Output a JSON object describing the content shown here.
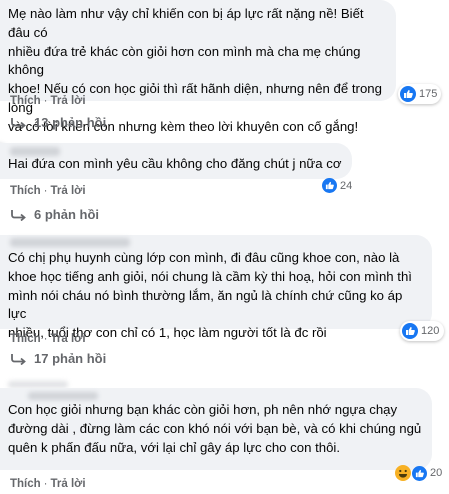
{
  "comments": [
    {
      "text": "Mẹ nào làm như vậy chỉ khiến con bị áp lực rất nặng nề! Biết đâu có\nnhiều đứa trẻ khác còn giỏi hơn con mình mà cha mẹ chúng không\nkhoe! Nếu có con học giỏi thì rất hãnh diện, nhưng nên để trong lòng\nvà có lời khen con nhưng kèm theo lời khuyên con cố gắng!",
      "like_label": "Thích",
      "reply_label": "Trả lời",
      "reaction_count": "175",
      "replies_label": "13 phản hồi"
    },
    {
      "text": "Hai đứa con mình yêu cầu không cho đăng chút j nữa cơ",
      "like_label": "Thích",
      "reply_label": "Trả lời",
      "reaction_count": "24",
      "replies_label": "6 phản hồi"
    },
    {
      "text": "Có chị phụ huynh cùng lớp con mình, đi đâu cũng khoe con, nào là\nkhoe học tiếng anh giỏi, nói chung là cầm kỳ thi hoạ, hỏi con mình thì\nmình nói cháu nó bình thường lắm, ăn ngủ là chính chứ cũng ko áp lực\nnhiều, tuổi thơ con chỉ có 1, học làm người tốt là đc rồi",
      "like_label": "Thích",
      "reply_label": "Trả lời",
      "reaction_count": "120",
      "replies_label": "17 phản hồi"
    },
    {
      "text": "Con học giỏi nhưng bạn khác còn giỏi hơn, ph nên nhớ ngựa chạy\nđường dài , đừng làm các con khó nói với bạn bè, và có khi chúng ngủ\nquên k phấn đấu nữa, với lại chỉ gây áp lực cho con thôi.",
      "like_label": "Thích",
      "reply_label": "Trả lời",
      "reaction_count": "20"
    }
  ],
  "colors": {
    "bubble": "#f0f2f5",
    "meta": "#65676b",
    "like": "#1877f2",
    "haha": "#f7b125"
  },
  "icons": [
    "like-icon",
    "haha-icon",
    "reply-arrow-icon"
  ]
}
